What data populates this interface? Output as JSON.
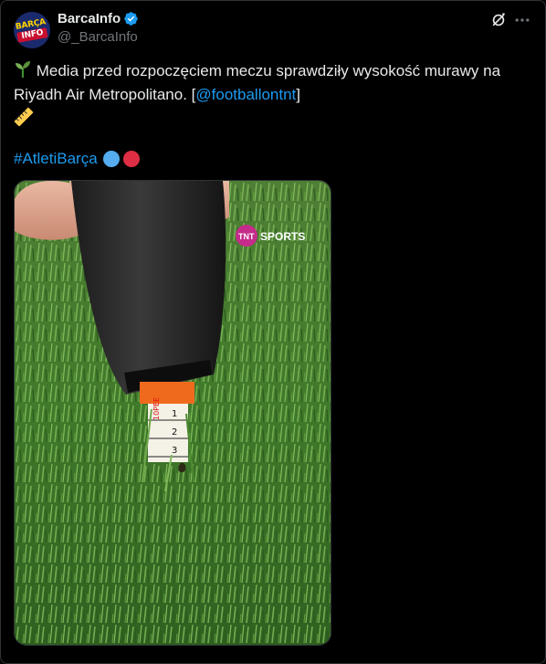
{
  "account": {
    "display_name": "BarcaInfo",
    "handle": "@_BarcaInfo",
    "avatar_text_top": "BARÇA",
    "avatar_text_bottom": "INFO"
  },
  "tweet": {
    "line1": "Media przed rozpoczęciem meczu sprawdziły wysokość murawy na",
    "line2_prefix": "Riyadh Air Metropolitano. [",
    "mention": "@footballontnt",
    "line2_suffix": "]",
    "hashtag": "#AtletiBarça",
    "emoji_first": "seedling-emoji",
    "emoji_second": "ruler-emoji"
  },
  "media": {
    "watermark_brand": "TNT",
    "watermark_text": "SPORTS",
    "tape_numbers": [
      "1",
      "2",
      "3"
    ],
    "tape_brand": "10PEE"
  },
  "colors": {
    "background": "#000000",
    "text": "#e7e9ea",
    "muted": "#71767b",
    "link": "#1d9bf0",
    "verified": "#1d9bf0",
    "dot_blue": "#55acee",
    "dot_red": "#dd2e44",
    "tnt_pink": "#c52b8a"
  }
}
